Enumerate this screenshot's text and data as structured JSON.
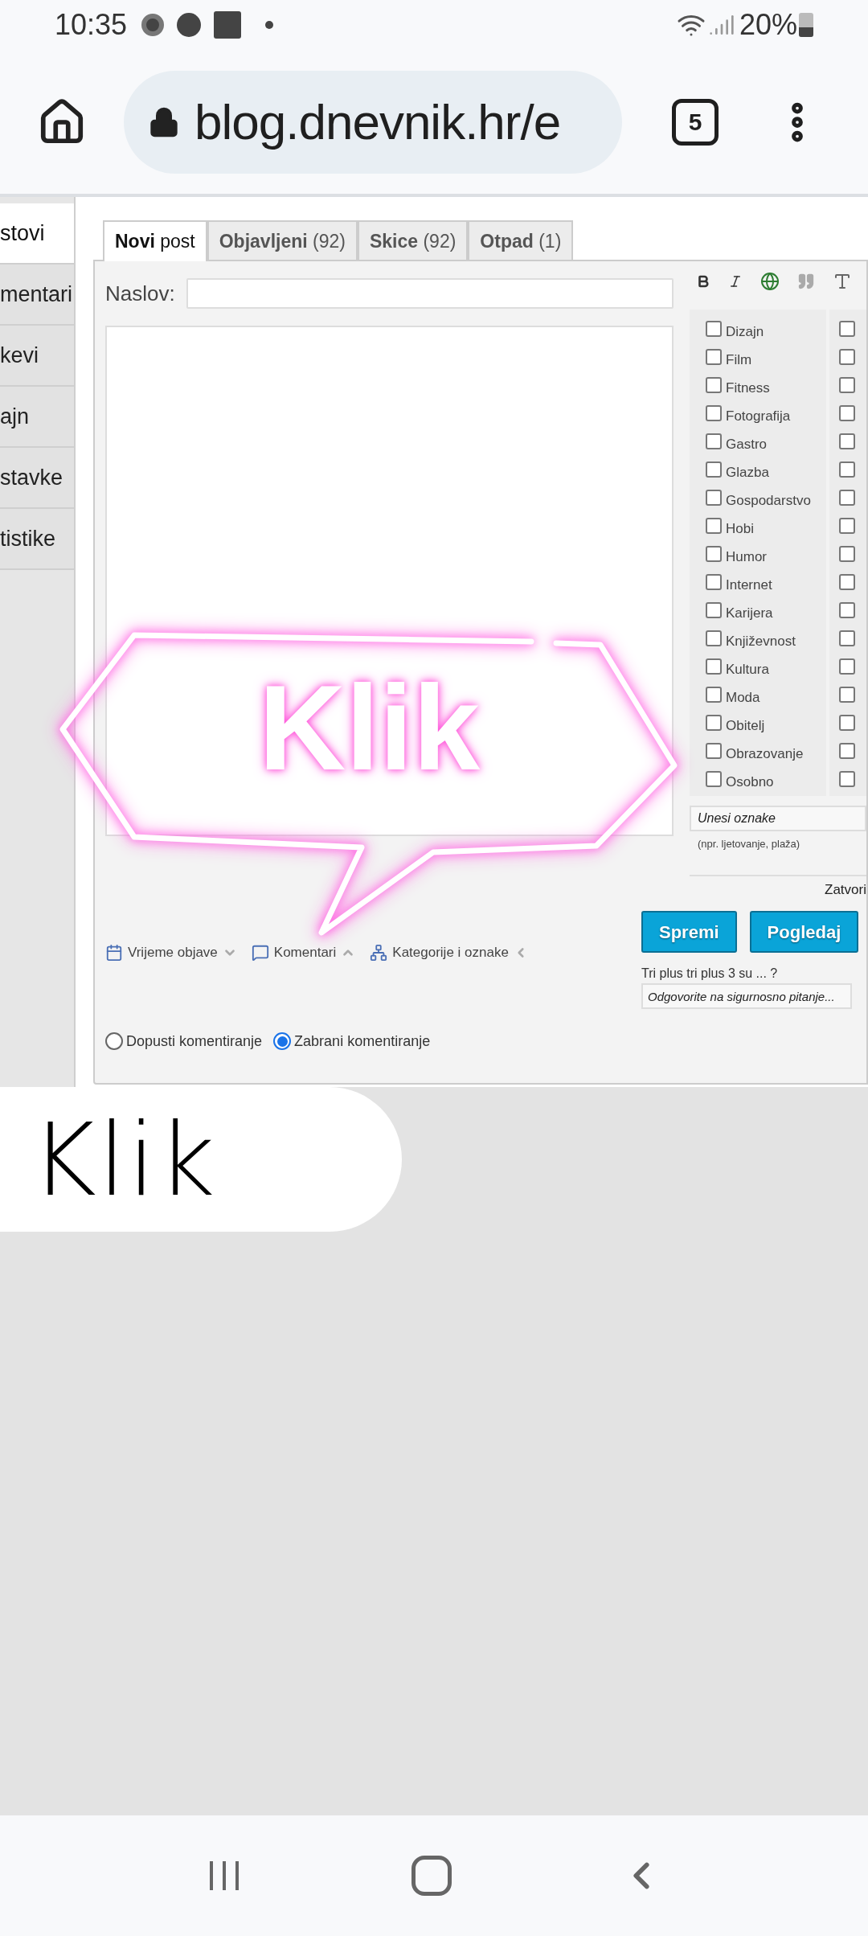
{
  "status_bar": {
    "time": "10:35",
    "battery": "20%"
  },
  "browser": {
    "url": "blog.dnevnik.hr/e",
    "tab_count": "5"
  },
  "sidebar": {
    "items": [
      {
        "label": "stovi",
        "selected": true
      },
      {
        "label": "mentari",
        "selected": false
      },
      {
        "label": "kevi",
        "selected": false
      },
      {
        "label": "ajn",
        "selected": false
      },
      {
        "label": "stavke",
        "selected": false
      },
      {
        "label": "tistike",
        "selected": false
      }
    ]
  },
  "tabs": [
    {
      "label": "**Novi** post",
      "selected": true
    },
    {
      "label": "**Objavljeni** (92)",
      "selected": false
    },
    {
      "label": "**Skice** (92)",
      "selected": false
    },
    {
      "label": "**Otpad** (1)",
      "selected": false
    }
  ],
  "title_field": {
    "label": "Naslov:"
  },
  "categories": [
    {
      "label": "Dizajn",
      "checked": false
    },
    {
      "label": "Film",
      "checked": false
    },
    {
      "label": "Fitness",
      "checked": false
    },
    {
      "label": "Fotografija",
      "checked": false
    },
    {
      "label": "Gastro",
      "checked": false
    },
    {
      "label": "Glazba",
      "checked": false
    },
    {
      "label": "Gospodarstvo",
      "checked": false
    },
    {
      "label": "Hobi",
      "checked": false
    },
    {
      "label": "Humor",
      "checked": false
    },
    {
      "label": "Internet",
      "checked": false
    },
    {
      "label": "Karijera",
      "checked": false
    },
    {
      "label": "Književnost",
      "checked": false
    },
    {
      "label": "Kultura",
      "checked": false
    },
    {
      "label": "Moda",
      "checked": false
    },
    {
      "label": "Obitelj",
      "checked": false
    },
    {
      "label": "Obrazovanje",
      "checked": false
    },
    {
      "label": "Osobno",
      "checked": false
    }
  ],
  "categories_column_2": [
    {
      "checked": false
    },
    {
      "checked": false
    },
    {
      "checked": false
    },
    {
      "checked": false
    },
    {
      "checked": false
    },
    {
      "checked": false
    },
    {
      "checked": false
    },
    {
      "checked": false
    },
    {
      "checked": false
    },
    {
      "checked": false
    },
    {
      "checked": false
    },
    {
      "checked": false
    },
    {
      "checked": false
    },
    {
      "checked": false
    },
    {
      "checked": false
    },
    {
      "checked": false
    },
    {
      "checked": false
    }
  ],
  "tags_field": {
    "placeholder": "Unesi oznake",
    "hint": "(npr. ljetovanje, plaža)"
  },
  "close_link": "Zatvori",
  "options": [
    {
      "label": "Vrijeme objave",
      "kind": "calendar",
      "expanded": false
    },
    {
      "label": "Komentari",
      "kind": "comment",
      "expanded": true
    },
    {
      "label": "Kategorije i oznake",
      "kind": "categories",
      "expanded": true
    }
  ],
  "buttons": [
    "Spremi",
    "Pogledaj"
  ],
  "security": {
    "question": "Tri plus tri plus 3 su ... ?",
    "placeholder": "Odgovorite na sigurnosno pitanje..."
  },
  "comment_options": [
    {
      "label": "Dopusti komentiranje",
      "selected": false
    },
    {
      "label": "Zabrani komentiranje",
      "selected": true
    }
  ],
  "stickers": [
    {
      "kind": "neon",
      "text": "Klik"
    },
    {
      "kind": "bubble",
      "text": "Klik"
    }
  ]
}
